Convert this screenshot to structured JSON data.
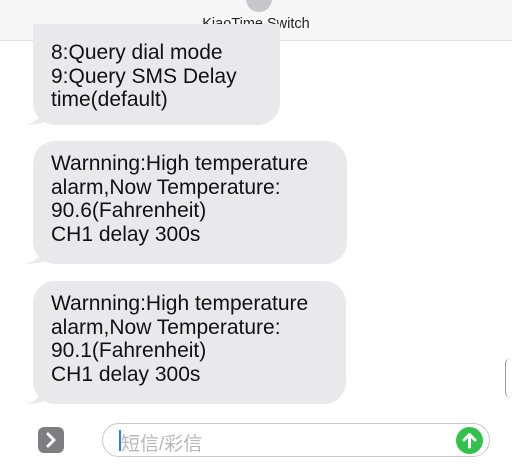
{
  "header": {
    "title": "KiaoTime Switch"
  },
  "messages": [
    {
      "lines": [
        "8:Query dial mode",
        "9:Query SMS Delay",
        "time(default)"
      ]
    },
    {
      "lines": [
        "Warnning:High temperature",
        "alarm,Now Temperature:",
        "90.6(Fahrenheit)",
        "CH1 delay 300s"
      ]
    },
    {
      "lines": [
        "Warnning:High temperature",
        "alarm,Now Temperature:",
        "90.1(Fahrenheit)",
        "CH1 delay 300s"
      ]
    }
  ],
  "composer": {
    "placeholder": "短信/彩信"
  },
  "colors": {
    "bubble": "#e9e9eb",
    "send": "#32c24b",
    "expand": "#7d7d82"
  },
  "icons": {
    "expand": "chevron-right-icon",
    "send": "arrow-up-icon"
  }
}
